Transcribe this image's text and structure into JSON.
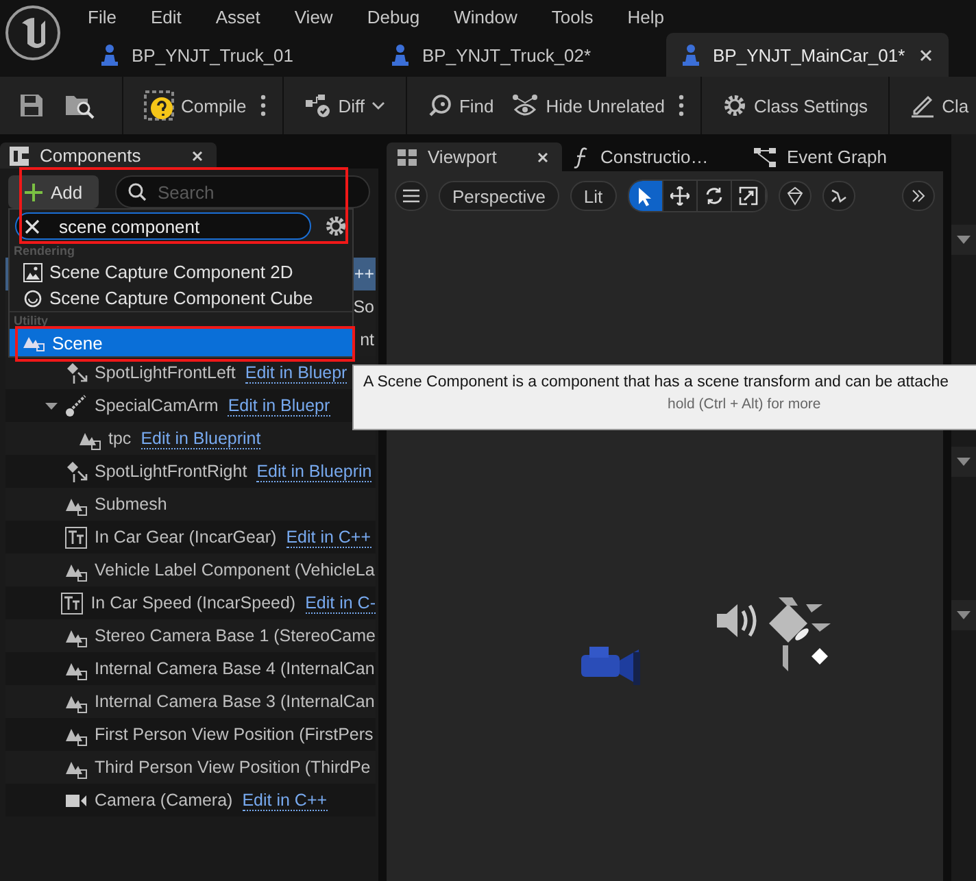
{
  "app_menu": [
    "File",
    "Edit",
    "Asset",
    "View",
    "Debug",
    "Window",
    "Tools",
    "Help"
  ],
  "document_tabs": [
    {
      "label": "BP_YNJT_Truck_01",
      "selected": false
    },
    {
      "label": "BP_YNJT_Truck_02*",
      "selected": false
    },
    {
      "label": "BP_YNJT_MainCar_01*",
      "selected": true
    }
  ],
  "toolbar": [
    {
      "kind": "compile",
      "label": "Compile"
    },
    {
      "kind": "diff",
      "label": "Diff"
    },
    {
      "kind": "find",
      "label": "Find"
    },
    {
      "kind": "hide",
      "label": "Hide Unrelated"
    },
    {
      "kind": "settings",
      "label": "Class Settings"
    },
    {
      "kind": "defaults",
      "label": "Cla"
    }
  ],
  "components_panel": {
    "title": "Components",
    "add_label": "Add",
    "search_placeholder": "Search",
    "covered_rows": [
      {
        "text": "++",
        "selected": true
      },
      {
        "text": "So",
        "selected": false
      },
      {
        "text": "nt",
        "selected": false
      }
    ],
    "tree": [
      {
        "kind": "spotlight",
        "name": "SpotLightFrontLeft",
        "link": "Edit in Bluepr"
      },
      {
        "kind": "arm",
        "name": "SpecialCamArm",
        "link": "Edit in Bluepr",
        "expanded": true,
        "children": [
          {
            "kind": "scene",
            "name": "tpc",
            "link": "Edit in Blueprint"
          }
        ]
      },
      {
        "kind": "spotlight",
        "name": "SpotLightFrontRight",
        "link": "Edit in Blueprin"
      },
      {
        "kind": "scene",
        "name": "Submesh"
      },
      {
        "kind": "text",
        "name": "In Car Gear (IncarGear)",
        "link": "Edit in C++"
      },
      {
        "kind": "scene",
        "name": "Vehicle Label Component (VehicleLa"
      },
      {
        "kind": "text",
        "name": "In Car Speed (IncarSpeed)",
        "link": "Edit in C-"
      },
      {
        "kind": "scene",
        "name": "Stereo Camera Base 1 (StereoCame"
      },
      {
        "kind": "scene",
        "name": "Internal Camera Base 4 (InternalCan"
      },
      {
        "kind": "scene",
        "name": "Internal Camera Base 3 (InternalCan"
      },
      {
        "kind": "scene",
        "name": "First Person View Position (FirstPers"
      },
      {
        "kind": "scene",
        "name": "Third Person View Position (ThirdPe"
      },
      {
        "kind": "camera",
        "name": "Camera (Camera)",
        "link": "Edit in C++"
      }
    ]
  },
  "add_menu": {
    "search_value": "scene component",
    "sections": [
      {
        "title": "Rendering",
        "items": [
          {
            "kind": "capture2d",
            "label": "Scene Capture Component 2D",
            "selected": false
          },
          {
            "kind": "capturecube",
            "label": "Scene Capture Component Cube",
            "selected": false
          }
        ]
      },
      {
        "title": "Utility",
        "items": [
          {
            "kind": "scene",
            "label": "Scene",
            "selected": true
          }
        ]
      }
    ]
  },
  "tooltip": {
    "text": "A Scene Component is a component that has a scene transform and can be attache",
    "hint": "hold (Ctrl + Alt) for more"
  },
  "viewport": {
    "tabs": [
      {
        "kind": "viewport",
        "label": "Viewport",
        "selected": true
      },
      {
        "kind": "function",
        "label": "Constructio…",
        "selected": false
      },
      {
        "kind": "graph",
        "label": "Event Graph",
        "selected": false
      }
    ],
    "perspective": "Perspective",
    "lit": "Lit",
    "tools": [
      {
        "kind": "select",
        "selected": true
      },
      {
        "kind": "move",
        "selected": false
      },
      {
        "kind": "rotate",
        "selected": false
      },
      {
        "kind": "scale",
        "selected": false
      }
    ]
  }
}
